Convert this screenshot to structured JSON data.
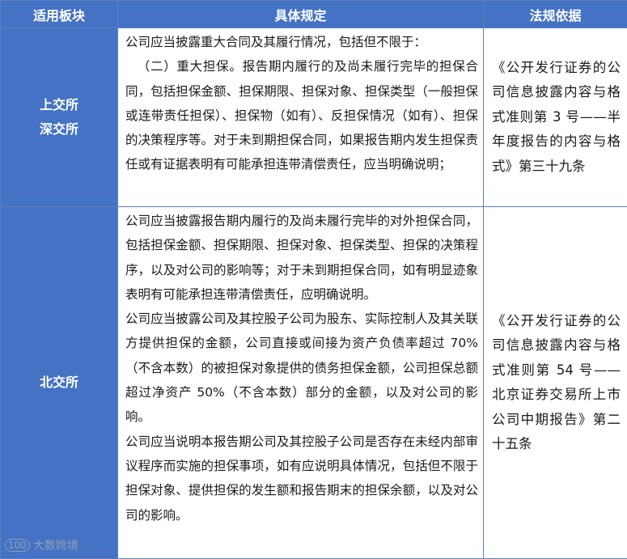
{
  "header": {
    "col1": "适用板块",
    "col2": "具体规定",
    "col3": "法规依据"
  },
  "rows": [
    {
      "region_line1": "上交所",
      "region_line2": "深交所",
      "content_p1": "公司应当披露重大合同及其履行情况，包括但不限于：",
      "content_p2": "（二）重大担保。报告期内履行的及尚未履行完毕的担保合同，包括担保金额、担保期限、担保对象、担保类型（一般担保或连带责任担保）、担保物（如有）、反担保情况（如有）、担保的决策程序等。对于未到期担保合同，如果报告期内发生担保责任或有证据表明有可能承担连带清偿责任，应当明确说明；",
      "basis": "《公开发行证券的公司信息披露内容与格式准则第 3 号——半年度报告的内容与格式》第三十九条"
    },
    {
      "region_line1": "北交所",
      "content_p1": "公司应当披露报告期内履行的及尚未履行完毕的对外担保合同，包括担保金额、担保期限、担保对象、担保类型、担保的决策程序，以及对公司的影响等；对于未到期担保合同，如有明显迹象表明有可能承担连带清偿责任，应明确说明。",
      "content_p2": "公司应当披露公司及其控股子公司为股东、实际控制人及其关联方提供担保的金额，公司直接或间接为资产负债率超过 70%（不含本数）的被担保对象提供的债务担保金额，公司担保总额超过净资产 50%（不含本数）部分的金额，以及对公司的影响。",
      "content_p3": "公司应当说明本报告期公司及其控股子公司是否存在未经内部审议程序而实施的担保事项，如有应说明具体情况，包括但不限于担保对象、提供担保的发生额和报告期末的担保余额，以及对公司的影响。",
      "basis": "《公开发行证券的公司信息披露内容与格式准则第 54 号——北京证券交易所上市公司中期报告》第二十五条"
    }
  ],
  "watermark": {
    "logo": "100",
    "text": "大数跨境"
  }
}
